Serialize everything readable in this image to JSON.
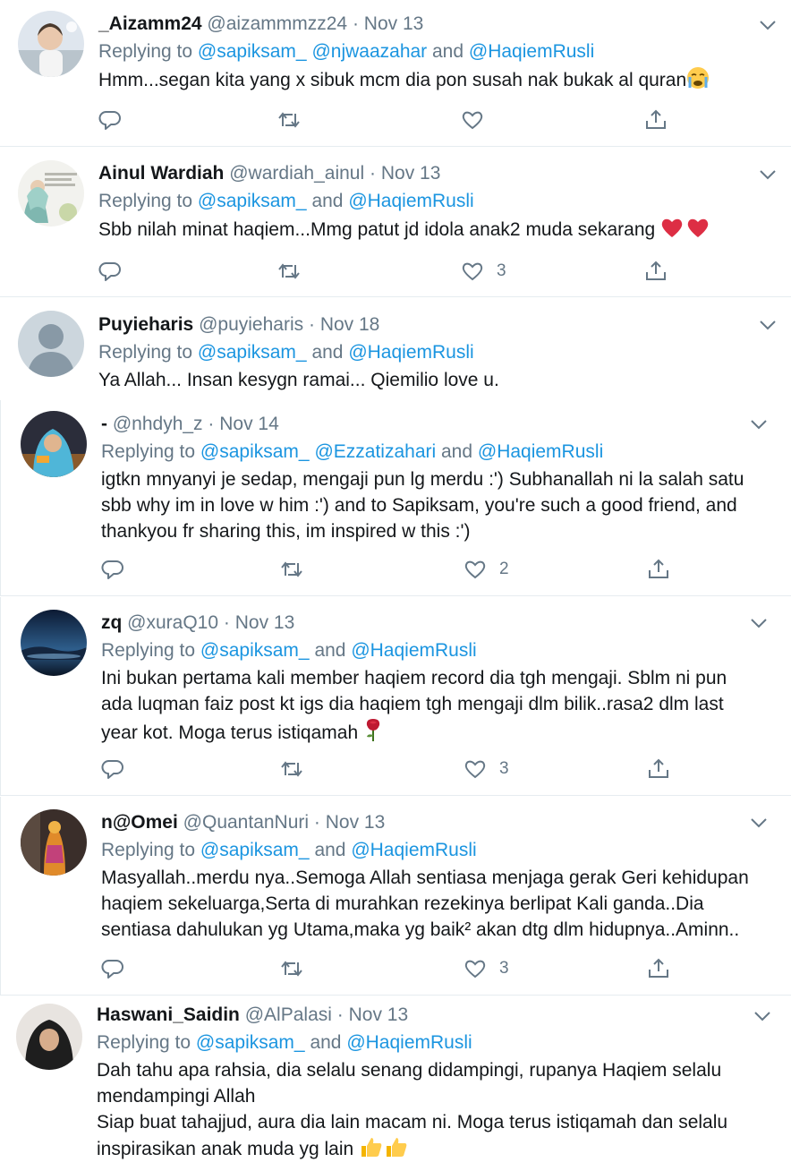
{
  "tweets": [
    {
      "name": "_Aizamm24",
      "handle": "@aizammmzz24",
      "date": "Nov 13",
      "reply_prefix": "Replying to",
      "reply_mentions": [
        "@sapiksam_",
        "@njwaazahar",
        "@HaqiemRusli"
      ],
      "reply_joiners": [
        " ",
        " and "
      ],
      "text": "Hmm...segan kita yang x sibuk mcm dia pon susah nak bukak al quran",
      "emoji": "crying-face",
      "likes": ""
    },
    {
      "name": "Ainul Wardiah",
      "handle": "@wardiah_ainul",
      "date": "Nov 13",
      "reply_prefix": "Replying to",
      "reply_mentions": [
        "@sapiksam_",
        "@HaqiemRusli"
      ],
      "reply_joiners": [
        " and "
      ],
      "text": "Sbb nilah minat haqiem...Mmg patut jd idola anak2 muda sekarang",
      "emoji": "red-hearts",
      "likes": "3"
    },
    {
      "name": "Puyieharis",
      "handle": "@puyieharis",
      "date": "Nov 18",
      "reply_prefix": "Replying to",
      "reply_mentions": [
        "@sapiksam_",
        "@HaqiemRusli"
      ],
      "reply_joiners": [
        " and "
      ],
      "text": "Ya Allah... Insan kesygn ramai... Qiemilio love u.",
      "emoji": "",
      "likes": ""
    },
    {
      "name": "-",
      "handle": "@nhdyh_z",
      "date": "Nov 14",
      "reply_prefix": "Replying to",
      "reply_mentions": [
        "@sapiksam_",
        "@Ezzatizahari",
        "@HaqiemRusli"
      ],
      "reply_joiners": [
        " ",
        " and "
      ],
      "text": "igtkn mnyanyi je sedap, mengaji pun lg merdu :') Subhanallah ni la salah satu\nsbb why im in love w him :') and to Sapiksam, you're such a good friend, and\nthankyou fr sharing this, im inspired w this :')",
      "emoji": "",
      "likes": "2"
    },
    {
      "name": "zq",
      "handle": "@xuraQ10",
      "date": "Nov 13",
      "reply_prefix": "Replying to",
      "reply_mentions": [
        "@sapiksam_",
        "@HaqiemRusli"
      ],
      "reply_joiners": [
        " and "
      ],
      "text": "Ini bukan pertama kali member haqiem record dia tgh mengaji. Sblm ni pun\nada luqman faiz post kt igs dia haqiem tgh mengaji dlm bilik..rasa2 dlm last\nyear kot. Moga terus istiqamah",
      "emoji": "rose",
      "likes": "3"
    },
    {
      "name": "n@Omei",
      "handle": "@QuantanNuri",
      "date": "Nov 13",
      "reply_prefix": "Replying to",
      "reply_mentions": [
        "@sapiksam_",
        "@HaqiemRusli"
      ],
      "reply_joiners": [
        " and "
      ],
      "text": "Masyallah..merdu nya..Semoga Allah sentiasa menjaga gerak Geri kehidupan\nhaqiem sekeluarga,Serta di murahkan rezekinya berlipat Kali ganda..Dia\nsentiasa dahulukan yg Utama,maka yg baik² akan dtg dlm hidupnya..Aminn..",
      "emoji": "",
      "likes": "3"
    },
    {
      "name": "Haswani_Saidin",
      "handle": "@AlPalasi",
      "date": "Nov 13",
      "reply_prefix": "Replying to",
      "reply_mentions": [
        "@sapiksam_",
        "@HaqiemRusli"
      ],
      "reply_joiners": [
        " and "
      ],
      "text": "Dah tahu apa rahsia, dia selalu senang didampingi, rupanya Haqiem selalu\nmendampingi Allah\nSiap buat tahajjud, aura dia lain macam ni. Moga terus istiqamah dan selalu\ninspirasikan anak muda yg lain",
      "emoji": "thumbs-up-pair",
      "likes": ""
    }
  ],
  "icons": {
    "reply": "reply-icon",
    "retweet": "retweet-icon",
    "like": "heart-icon",
    "share": "share-icon",
    "caret": "chevron-down-icon"
  },
  "colors": {
    "link": "#1b95e0",
    "secondary": "#657786",
    "divider": "#e6ecf0",
    "heart": "#e0245e"
  }
}
